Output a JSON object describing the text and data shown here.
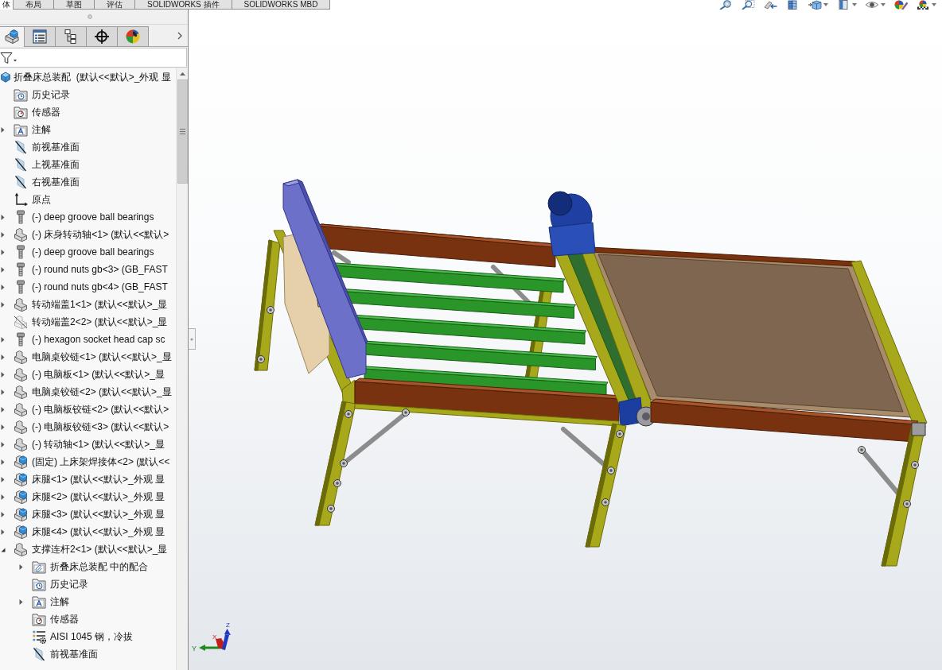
{
  "command_tabs": [
    {
      "label": "体",
      "selected": true
    },
    {
      "label": "布局",
      "selected": false
    },
    {
      "label": "草图",
      "selected": false
    },
    {
      "label": "评估",
      "selected": false
    },
    {
      "label": "SOLIDWORKS 插件",
      "selected": false
    },
    {
      "label": "SOLIDWORKS MBD",
      "selected": false
    }
  ],
  "view_toolbar": [
    {
      "kind": "zoom-to-fit",
      "dropdown": false
    },
    {
      "kind": "zoom-area",
      "dropdown": false
    },
    {
      "kind": "previous-view",
      "dropdown": false
    },
    {
      "kind": "section-view",
      "dropdown": false
    },
    {
      "kind": "view-orientation",
      "dropdown": true
    },
    {
      "kind": "display-style",
      "dropdown": true
    },
    {
      "kind": "hide-show",
      "dropdown": true
    },
    {
      "kind": "edit-appearance",
      "dropdown": false
    },
    {
      "kind": "scene",
      "dropdown": true
    }
  ],
  "panel_tabs": [
    {
      "kind": "feature-tree",
      "selected": true
    },
    {
      "kind": "property-manager",
      "selected": false
    },
    {
      "kind": "configuration-manager",
      "selected": false
    },
    {
      "kind": "dimxpert",
      "selected": false
    },
    {
      "kind": "display-manager",
      "selected": false
    }
  ],
  "feature_tree": {
    "label": "折叠床总装配  (默认<<默认>_外观 显",
    "kind": "assembly",
    "children": [
      {
        "label": "历史记录",
        "kind": "history",
        "expandable": false,
        "expanded": false
      },
      {
        "label": "传感器",
        "kind": "sensors",
        "expandable": false,
        "expanded": false
      },
      {
        "label": "注解",
        "kind": "annotations",
        "expandable": true,
        "expanded": false
      },
      {
        "label": "前视基准面",
        "kind": "plane",
        "expandable": false,
        "expanded": false
      },
      {
        "label": "上视基准面",
        "kind": "plane",
        "expandable": false,
        "expanded": false
      },
      {
        "label": "右视基准面",
        "kind": "plane",
        "expandable": false,
        "expanded": false
      },
      {
        "label": "原点",
        "kind": "origin",
        "expandable": false,
        "expanded": false
      },
      {
        "label": "(-) deep groove ball bearings",
        "kind": "fastener",
        "expandable": true,
        "expanded": false
      },
      {
        "label": "(-) 床身转动轴<1> (默认<<默认>",
        "kind": "part",
        "expandable": true,
        "expanded": false
      },
      {
        "label": "(-) deep groove ball bearings",
        "kind": "fastener",
        "expandable": true,
        "expanded": false
      },
      {
        "label": "(-) round nuts gb<3> (GB_FAST",
        "kind": "fastener",
        "expandable": true,
        "expanded": false
      },
      {
        "label": "(-) round nuts gb<4> (GB_FAST",
        "kind": "fastener",
        "expandable": true,
        "expanded": false
      },
      {
        "label": "转动端盖1<1> (默认<<默认>_显",
        "kind": "part",
        "expandable": true,
        "expanded": false
      },
      {
        "label": "转动端盖2<2> (默认<<默认>_显",
        "kind": "part-suppressed",
        "expandable": false,
        "expanded": false
      },
      {
        "label": "(-) hexagon socket head cap sc",
        "kind": "fastener",
        "expandable": true,
        "expanded": false
      },
      {
        "label": "电脑桌铰链<1> (默认<<默认>_显",
        "kind": "part",
        "expandable": true,
        "expanded": false
      },
      {
        "label": "(-) 电脑板<1> (默认<<默认>_显",
        "kind": "part",
        "expandable": true,
        "expanded": false
      },
      {
        "label": "电脑桌铰链<2> (默认<<默认>_显",
        "kind": "part",
        "expandable": true,
        "expanded": false
      },
      {
        "label": "(-) 电脑板铰链<2> (默认<<默认>",
        "kind": "part",
        "expandable": true,
        "expanded": false
      },
      {
        "label": "(-) 电脑板铰链<3> (默认<<默认>",
        "kind": "part",
        "expandable": true,
        "expanded": false
      },
      {
        "label": "(-) 转动轴<1> (默认<<默认>_显",
        "kind": "part",
        "expandable": true,
        "expanded": false
      },
      {
        "label": "(固定) 上床架焊接体<2> (默认<<",
        "kind": "subassembly",
        "expandable": true,
        "expanded": false
      },
      {
        "label": "床腿<1> (默认<<默认>_外观 显",
        "kind": "subassembly",
        "expandable": true,
        "expanded": false
      },
      {
        "label": "床腿<2> (默认<<默认>_外观 显",
        "kind": "subassembly",
        "expandable": true,
        "expanded": false
      },
      {
        "label": "床腿<3> (默认<<默认>_外观 显",
        "kind": "subassembly",
        "expandable": true,
        "expanded": false
      },
      {
        "label": "床腿<4> (默认<<默认>_外观 显",
        "kind": "subassembly",
        "expandable": true,
        "expanded": false
      },
      {
        "label": "支撑连杆2<1> (默认<<默认>_显",
        "kind": "part",
        "expandable": true,
        "expanded": true,
        "children": [
          {
            "label": "折叠床总装配 中的配合",
            "kind": "mates",
            "expandable": true,
            "expanded": false
          },
          {
            "label": "历史记录",
            "kind": "history",
            "expandable": false,
            "expanded": false
          },
          {
            "label": "注解",
            "kind": "annotations",
            "expandable": true,
            "expanded": false
          },
          {
            "label": "传感器",
            "kind": "sensors",
            "expandable": false,
            "expanded": false
          },
          {
            "label": "AISI 1045 钢，冷拔",
            "kind": "material",
            "expandable": false,
            "expanded": false
          },
          {
            "label": "前视基准面",
            "kind": "plane",
            "expandable": false,
            "expanded": false
          }
        ]
      }
    ]
  },
  "triad": {
    "x": "X",
    "y": "Y",
    "z": "Z"
  }
}
